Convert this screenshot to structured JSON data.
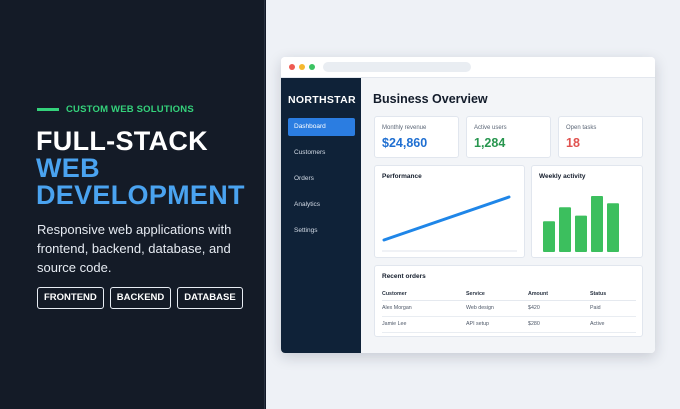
{
  "promo": {
    "tagline": "CUSTOM WEB SOLUTIONS",
    "headline": [
      "FULL-STACK",
      "WEB",
      "DEVELOPMENT"
    ],
    "description": "Responsive web applications with frontend, backend, database, and source code.",
    "chips": [
      "FRONTEND",
      "BACKEND",
      "DATABASE"
    ],
    "colors": {
      "accent_green": "#34d27b",
      "accent_blue": "#4aa3f0",
      "bg": "#141b27"
    }
  },
  "app": {
    "brand": "NORTHSTAR",
    "nav": [
      "Dashboard",
      "Customers",
      "Orders",
      "Analytics",
      "Settings"
    ],
    "active_nav": "Dashboard",
    "title": "Business Overview",
    "stats": [
      {
        "label": "Monthly revenue",
        "value": "$24,860",
        "color": "#1f6fd1"
      },
      {
        "label": "Active users",
        "value": "1,284",
        "color": "#28964f"
      },
      {
        "label": "Open tasks",
        "value": "18",
        "color": "#e0524f"
      }
    ],
    "performance": {
      "title": "Performance"
    },
    "weekly": {
      "title": "Weekly activity"
    },
    "orders": {
      "title": "Recent orders",
      "columns": [
        "Customer",
        "Service",
        "Amount",
        "Status"
      ],
      "rows": [
        [
          "Alex Morgan",
          "Web design",
          "$420",
          "Paid"
        ],
        [
          "Jamie Lee",
          "API setup",
          "$280",
          "Active"
        ]
      ]
    }
  },
  "chart_data": [
    {
      "type": "line",
      "title": "Performance",
      "x": [
        0,
        1
      ],
      "series": [
        {
          "values": [
            0,
            1
          ]
        }
      ],
      "ylim": [
        0,
        1
      ],
      "grid": false,
      "color": "#1f86e8"
    },
    {
      "type": "bar",
      "title": "Weekly activity",
      "categories": [
        "",
        "",
        "",
        "",
        ""
      ],
      "values": [
        55,
        80,
        65,
        100,
        87
      ],
      "ylim": [
        0,
        100
      ],
      "grid": false,
      "color": "#3cbf5e"
    }
  ]
}
